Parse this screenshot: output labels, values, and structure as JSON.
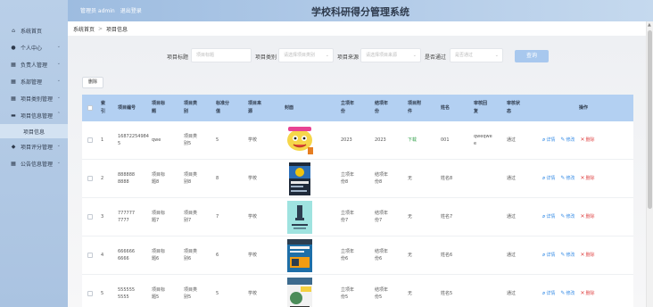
{
  "app": {
    "title": "学校科研得分管理系统",
    "role_user": "管理员 admin",
    "logout": "退出登录"
  },
  "sidebar": {
    "items": [
      {
        "label": "系统首页",
        "icon": "home-icon",
        "has_children": false
      },
      {
        "label": "个人中心",
        "icon": "person-icon",
        "has_children": true
      },
      {
        "label": "负责人管理",
        "icon": "grid-icon",
        "has_children": true
      },
      {
        "label": "系部管理",
        "icon": "grid-icon",
        "has_children": true
      },
      {
        "label": "项目类别管理",
        "icon": "grid-icon",
        "has_children": true
      },
      {
        "label": "项目信息管理",
        "icon": "chat-icon",
        "has_children": true,
        "expanded": true
      },
      {
        "label": "项目信息",
        "sub": true
      },
      {
        "label": "项目评分管理",
        "icon": "gem-icon",
        "has_children": true
      },
      {
        "label": "公告信息管理",
        "icon": "grid-icon",
        "has_children": true
      }
    ]
  },
  "breadcrumb": {
    "home": "系统首页",
    "separator": ">",
    "current": "项目信息"
  },
  "search": {
    "title_label": "项目标题",
    "title_placeholder": "项目标题",
    "category_label": "项目类别",
    "category_placeholder": "请选择项目类别",
    "source_label": "项目来源",
    "source_placeholder": "请选择项目来源",
    "approved_label": "是否通过",
    "approved_placeholder": "是否通过",
    "search_button": "查询"
  },
  "toolbar": {
    "delete_button": "删除"
  },
  "table": {
    "headers": {
      "index": "索\n引",
      "no": "项目编号",
      "title": "项目标\n题",
      "category": "项目类\n别",
      "score": "标准分\n值",
      "source": "项目来\n源",
      "cover": "封面",
      "year_start": "立项年\n份",
      "year_end": "结项年\n份",
      "file": "项目附\n件",
      "name": "姓名",
      "reply": "审核回\n复",
      "status": "审核状\n态",
      "ops": "操作"
    },
    "ops": {
      "detail": "详情",
      "edit": "修改",
      "delete": "删除"
    },
    "rows": [
      {
        "index": "1",
        "no": "168722549841\n5",
        "title": "qwe",
        "category": "项目类\n别5",
        "score": "5",
        "source": "学校",
        "year_start": "2023",
        "year_end": "2023",
        "file": "下载",
        "file_link": true,
        "name": "001",
        "reply": "qweqwe\ne",
        "status": "通过",
        "cover": "cartoon"
      },
      {
        "index": "2",
        "no": "888888\n8888",
        "title": "项目标\n题8",
        "category": "项目类\n别8",
        "score": "8",
        "source": "学校",
        "year_start": "立项年\n份8",
        "year_end": "结项年\n份8",
        "file": "无",
        "file_link": false,
        "name": "姓名8",
        "reply": "",
        "status": "通过",
        "cover": "python-dark"
      },
      {
        "index": "3",
        "no": "777777\n7777",
        "title": "项目标\n题7",
        "category": "项目类\n别7",
        "score": "7",
        "source": "学校",
        "year_start": "立项年\n份7",
        "year_end": "结项年\n份7",
        "file": "无",
        "file_link": false,
        "name": "姓名7",
        "reply": "",
        "status": "通过",
        "cover": "teal"
      },
      {
        "index": "4",
        "no": "666666\n6666",
        "title": "项目标\n题6",
        "category": "项目类\n别6",
        "score": "6",
        "source": "学校",
        "year_start": "立项年\n份6",
        "year_end": "结项年\n份6",
        "file": "无",
        "file_link": false,
        "name": "姓名6",
        "reply": "",
        "status": "通过",
        "cover": "wordpress"
      },
      {
        "index": "5",
        "no": "555555\n5555",
        "title": "项目标\n题5",
        "category": "项目类\n别5",
        "score": "5",
        "source": "学校",
        "year_start": "立项年\n份5",
        "year_end": "结项年\n份5",
        "file": "无",
        "file_link": false,
        "name": "姓名5",
        "reply": "",
        "status": "通过",
        "cover": "python-light"
      }
    ]
  },
  "colors": {
    "sidebar_bg": "#b9cfe8",
    "header_row": "#b3d0f2",
    "search_button": "#a8c8ee",
    "action_blue": "#3a8ee6",
    "action_red": "#e04b4b",
    "download_green": "#33a04b"
  }
}
